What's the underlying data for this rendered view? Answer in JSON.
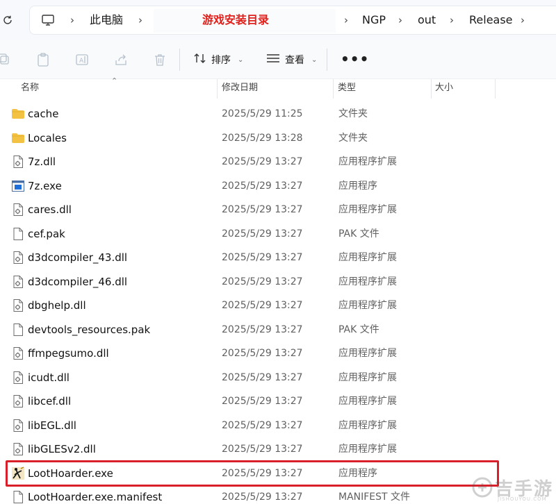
{
  "address_bar": {
    "crumbs": [
      "此电脑",
      "游戏安装目录",
      "NGP",
      "out",
      "Release"
    ]
  },
  "toolbar": {
    "sort_label": "排序",
    "view_label": "查看",
    "more_label": "•••"
  },
  "columns": {
    "name": "名称",
    "date": "修改日期",
    "type": "类型",
    "size": "大小"
  },
  "files": [
    {
      "name": "cache",
      "date": "2025/5/29 11:25",
      "type": "文件夹",
      "icon": "folder"
    },
    {
      "name": "Locales",
      "date": "2025/5/29 13:28",
      "type": "文件夹",
      "icon": "folder"
    },
    {
      "name": "7z.dll",
      "date": "2025/5/29 13:27",
      "type": "应用程序扩展",
      "icon": "dll"
    },
    {
      "name": "7z.exe",
      "date": "2025/5/29 13:27",
      "type": "应用程序",
      "icon": "exe"
    },
    {
      "name": "cares.dll",
      "date": "2025/5/29 13:27",
      "type": "应用程序扩展",
      "icon": "dll"
    },
    {
      "name": "cef.pak",
      "date": "2025/5/29 13:27",
      "type": "PAK 文件",
      "icon": "file"
    },
    {
      "name": "d3dcompiler_43.dll",
      "date": "2025/5/29 13:27",
      "type": "应用程序扩展",
      "icon": "dll"
    },
    {
      "name": "d3dcompiler_46.dll",
      "date": "2025/5/29 13:27",
      "type": "应用程序扩展",
      "icon": "dll"
    },
    {
      "name": "dbghelp.dll",
      "date": "2025/5/29 13:27",
      "type": "应用程序扩展",
      "icon": "dll"
    },
    {
      "name": "devtools_resources.pak",
      "date": "2025/5/29 13:27",
      "type": "PAK 文件",
      "icon": "file"
    },
    {
      "name": "ffmpegsumo.dll",
      "date": "2025/5/29 13:27",
      "type": "应用程序扩展",
      "icon": "dll"
    },
    {
      "name": "icudt.dll",
      "date": "2025/5/29 13:27",
      "type": "应用程序扩展",
      "icon": "dll"
    },
    {
      "name": "libcef.dll",
      "date": "2025/5/29 13:27",
      "type": "应用程序扩展",
      "icon": "dll"
    },
    {
      "name": "libEGL.dll",
      "date": "2025/5/29 13:27",
      "type": "应用程序扩展",
      "icon": "dll"
    },
    {
      "name": "libGLESv2.dll",
      "date": "2025/5/29 13:27",
      "type": "应用程序扩展",
      "icon": "dll"
    },
    {
      "name": "LootHoarder.exe",
      "date": "2025/5/29 13:27",
      "type": "应用程序",
      "icon": "game-exe"
    },
    {
      "name": "LootHoarder.exe.manifest",
      "date": "2025/5/29 13:27",
      "type": "MANIFEST 文件",
      "icon": "file"
    }
  ],
  "watermark": {
    "text": "吉手游",
    "sub": "JISHOUYOU.COM"
  },
  "colors": {
    "highlight": "#d9202a",
    "folder": "#f4c242",
    "crumb_highlight": "#e0201b"
  }
}
